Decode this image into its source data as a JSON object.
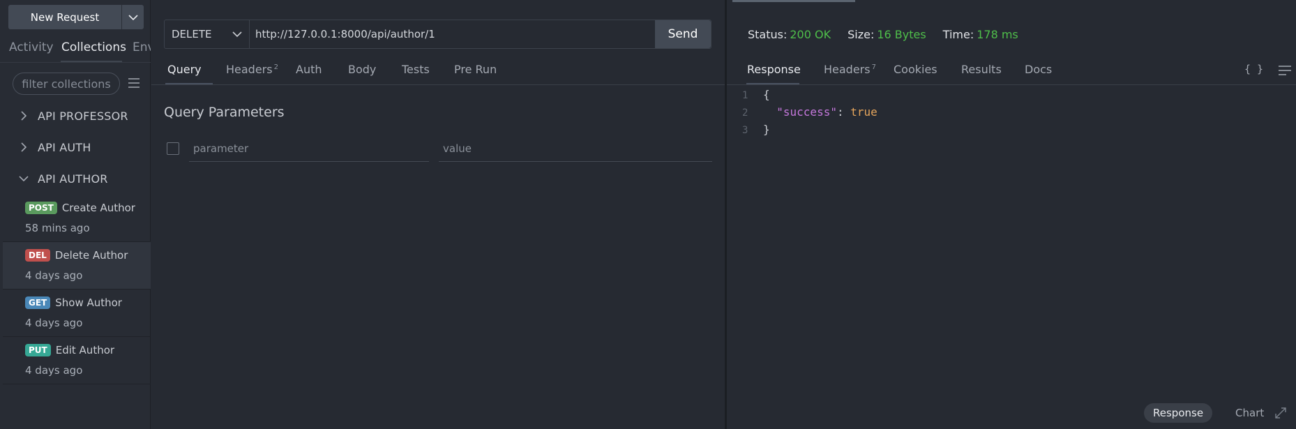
{
  "sidebar": {
    "new_request_label": "New Request",
    "tabs": [
      "Activity",
      "Collections",
      "Env"
    ],
    "filter_placeholder": "filter collections",
    "folders": [
      {
        "name": "API PROFESSOR",
        "expanded": false
      },
      {
        "name": "API AUTH",
        "expanded": false
      },
      {
        "name": "API AUTHOR",
        "expanded": true
      }
    ],
    "requests": [
      {
        "method": "POST",
        "name": "Create Author",
        "time": "58 mins ago",
        "color": "#5a9a5e"
      },
      {
        "method": "DEL",
        "name": "Delete Author",
        "time": "4 days ago",
        "color": "#c0504d"
      },
      {
        "method": "GET",
        "name": "Show Author",
        "time": "4 days ago",
        "color": "#4a88b8"
      },
      {
        "method": "PUT",
        "name": "Edit Author",
        "time": "4 days ago",
        "color": "#36a895"
      }
    ]
  },
  "request": {
    "method": "DELETE",
    "url": "http://127.0.0.1:8000/api/author/1",
    "send_label": "Send",
    "tabs": [
      {
        "label": "Query"
      },
      {
        "label": "Headers",
        "count": "2"
      },
      {
        "label": "Auth"
      },
      {
        "label": "Body"
      },
      {
        "label": "Tests"
      },
      {
        "label": "Pre Run"
      }
    ],
    "query_title": "Query Parameters",
    "param_placeholder": "parameter",
    "value_placeholder": "value"
  },
  "response": {
    "status_label": "Status:",
    "status_value": "200 OK",
    "size_label": "Size:",
    "size_value": "16 Bytes",
    "time_label": "Time:",
    "time_value": "178 ms",
    "tabs": [
      {
        "label": "Response"
      },
      {
        "label": "Headers",
        "count": "7"
      },
      {
        "label": "Cookies"
      },
      {
        "label": "Results"
      },
      {
        "label": "Docs"
      }
    ],
    "braces_label": "{ }",
    "code": {
      "line_numbers": [
        "1",
        "2",
        "3"
      ],
      "open": "{",
      "key": "\"success\"",
      "colon": ": ",
      "value": "true",
      "close": "}"
    },
    "bottom_tabs": [
      "Response",
      "Chart"
    ]
  },
  "colors": {
    "accent_green": "#4fbf4a",
    "json_key": "#c678dd",
    "json_bool": "#e5a55c"
  }
}
